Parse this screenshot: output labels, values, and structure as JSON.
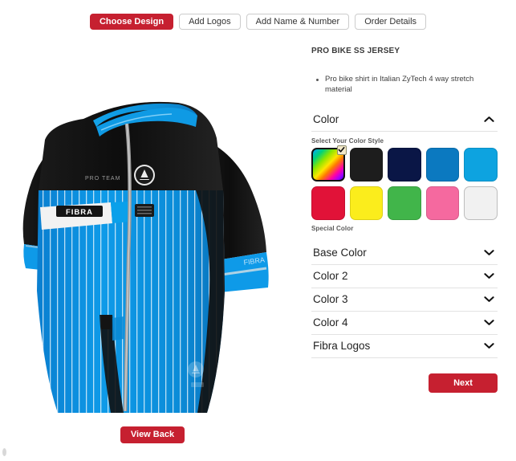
{
  "tabs": [
    {
      "label": "Choose Design",
      "active": true
    },
    {
      "label": "Add Logos",
      "active": false
    },
    {
      "label": "Add Name & Number",
      "active": false
    },
    {
      "label": "Order Details",
      "active": false
    }
  ],
  "preview": {
    "view_back_label": "View Back",
    "jersey": {
      "chest_logo_text": "FIBRA",
      "sleeve_text": "FIBRA",
      "upper_tag_text": "PRO TEAM",
      "base_color": "#0b90e0",
      "accent_color": "#00a6e8",
      "body_color": "#141414",
      "stripe_color": "#ffffff",
      "zipper_color": "#9a9a9a"
    }
  },
  "panel": {
    "product_title": "PRO BIKE SS JERSEY",
    "features": [
      "Pro bike shirt in Italian ZyTech 4 way stretch material"
    ],
    "color_section": {
      "title": "Color",
      "expanded": true,
      "chevron": "chevron-up-icon",
      "select_style_label": "Select Your Color Style",
      "special_color_label": "Special Color",
      "swatches_row1": [
        {
          "name": "rainbow",
          "color": "rainbow",
          "selected": true
        },
        {
          "name": "black",
          "color": "#1d1d1d",
          "selected": false
        },
        {
          "name": "navy",
          "color": "#0a1646",
          "selected": false
        },
        {
          "name": "blue",
          "color": "#0b79c0",
          "selected": false
        },
        {
          "name": "light-blue",
          "color": "#0da3e0",
          "selected": false
        }
      ],
      "swatches_row2": [
        {
          "name": "red",
          "color": "#e11238",
          "selected": false
        },
        {
          "name": "yellow",
          "color": "#fbed1c",
          "selected": false
        },
        {
          "name": "green",
          "color": "#41b54a",
          "selected": false
        },
        {
          "name": "pink",
          "color": "#f濃",
          "selected": false
        },
        {
          "name": "white",
          "color": "#f1f1f1",
          "selected": false
        }
      ]
    },
    "accordions": [
      {
        "title": "Base Color",
        "chevron": "chevron-down-icon"
      },
      {
        "title": "Color 2",
        "chevron": "chevron-down-icon"
      },
      {
        "title": "Color 3",
        "chevron": "chevron-down-icon"
      },
      {
        "title": "Color 4",
        "chevron": "chevron-down-icon"
      },
      {
        "title": "Fibra Logos",
        "chevron": "chevron-down-icon"
      }
    ],
    "next_label": "Next"
  },
  "colors": {
    "brand_red": "#c62030",
    "panel_divider": "#e2e2e2",
    "text_dark": "#222222"
  }
}
